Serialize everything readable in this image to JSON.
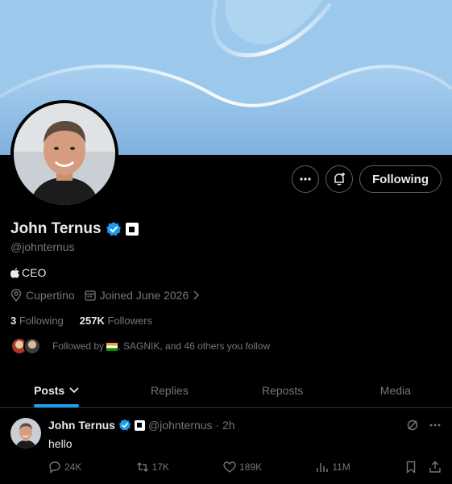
{
  "profile": {
    "name": "John Ternus",
    "handle": "@johnternus",
    "bio": "CEO",
    "location": "Cupertino",
    "joined": "Joined June 2026",
    "following_count": "3",
    "following_label": "Following",
    "followers_count": "257K",
    "followers_label": "Followers",
    "followed_by_prefix": "Followed by",
    "followed_by_suffix": ", SAGNIK, and 46 others you follow"
  },
  "actions": {
    "more_icon": "more-icon",
    "notify_icon": "bell-plus-icon",
    "follow_label": "Following"
  },
  "tabs": [
    {
      "label": "Posts",
      "active": true
    },
    {
      "label": "Replies",
      "active": false
    },
    {
      "label": "Reposts",
      "active": false
    },
    {
      "label": "Media",
      "active": false
    }
  ],
  "tweet": {
    "name": "John Ternus",
    "handle_time": "@johnternus · 2h",
    "text": "hello",
    "replies": "24K",
    "reposts": "17K",
    "likes": "189K",
    "views": "11M"
  },
  "colors": {
    "accent": "#1d9bf0",
    "muted": "#71767b",
    "border": "#2f3336",
    "text": "#e7e9ea",
    "background": "#000000"
  }
}
